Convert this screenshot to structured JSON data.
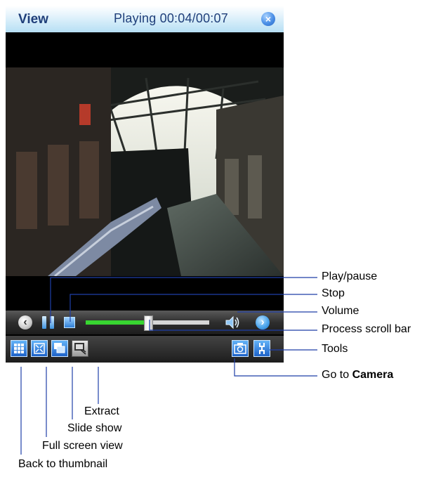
{
  "window": {
    "title": "View",
    "status": "Playing 00:04/00:07",
    "close_glyph": "×"
  },
  "player": {
    "progress_fraction": 0.5,
    "state": "playing"
  },
  "annotations": {
    "play_pause": "Play/pause",
    "stop": "Stop",
    "volume": "Volume",
    "process_scroll_bar": "Process scroll bar",
    "tools": "Tools",
    "go_to": "Go to ",
    "camera": "Camera",
    "extract": "Extract",
    "slide_show": "Slide show",
    "full_screen_view": "Full screen view",
    "back_to_thumbnail": "Back to thumbnail"
  },
  "colors": {
    "title_text": "#1f3f7a",
    "progress_fill": "#38d631",
    "accent_blue": "#2f7fd6",
    "callout_line": "#1f3fa8"
  }
}
